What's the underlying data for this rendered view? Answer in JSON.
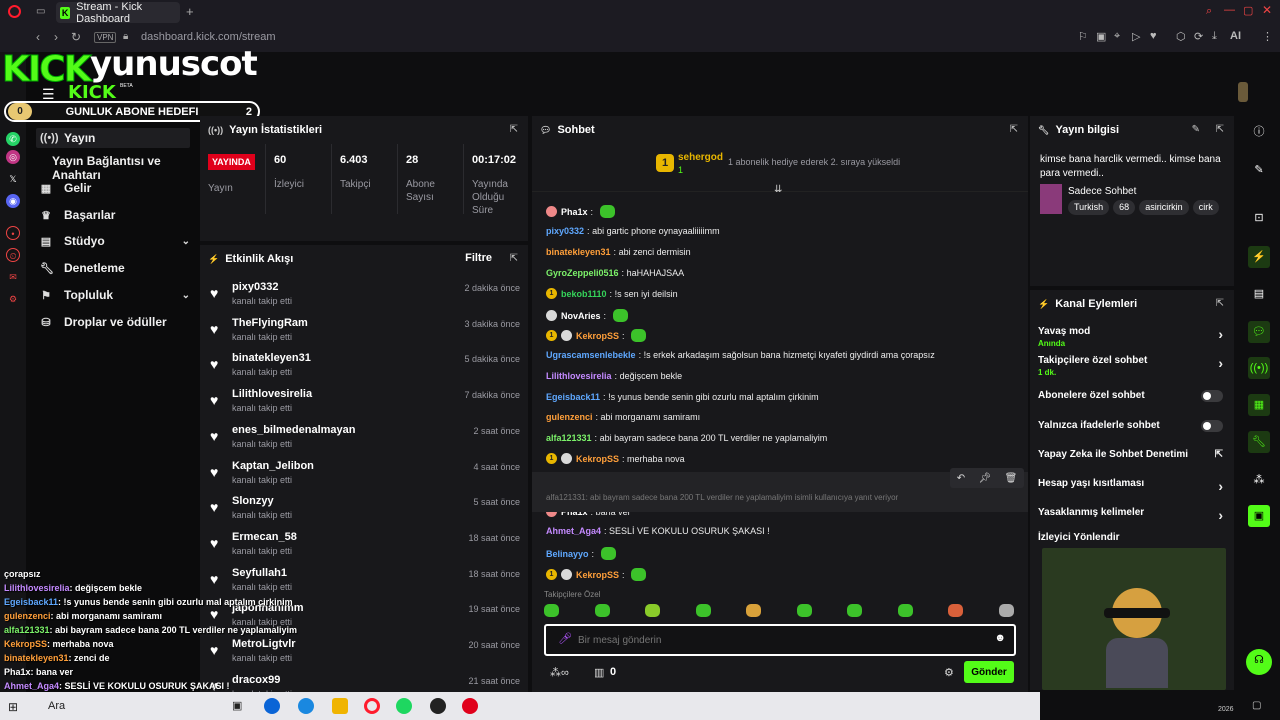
{
  "browser": {
    "tab_title": "Stream - Kick Dashboard",
    "url": "dashboard.kick.com/stream",
    "vpn": "VPN",
    "ai": "AI"
  },
  "overlay": {
    "brand": "KICK",
    "channel": "yunuscot",
    "brand_small": "KICK",
    "beta": "BETA",
    "goal_title": "GUNLUK ABONE HEDEFI",
    "goal_current": "0",
    "goal_target": "2"
  },
  "sidenav": [
    {
      "label": "Yayın",
      "icon": "broadcast-icon"
    },
    {
      "label": "Yayın Bağlantısı ve Anahtarı",
      "icon": ""
    },
    {
      "label": "Gelir",
      "icon": "chart-icon"
    },
    {
      "label": "Başarılar",
      "icon": "trophy-icon"
    },
    {
      "label": "Stüdyo",
      "icon": "studio-icon"
    },
    {
      "label": "Denetleme",
      "icon": "wrench-icon"
    },
    {
      "label": "Topluluk",
      "icon": "community-icon"
    },
    {
      "label": "Droplar ve ödüller",
      "icon": "drops-icon"
    }
  ],
  "stats": {
    "title": "Yayın İstatistikleri",
    "live_badge": "YAYINDA",
    "live_label": "Yayın",
    "viewers": "60",
    "viewers_label": "İzleyici",
    "followers": "6.403",
    "followers_label": "Takipçi",
    "subs": "28",
    "subs_label": "Abone Sayısı",
    "uptime": "00:17:02",
    "uptime_label": "Yayında Olduğu Süre"
  },
  "activity": {
    "title": "Etkinlik Akışı",
    "filter": "Filtre",
    "action": "kanalı takip etti",
    "events": [
      {
        "name": "pixy0332",
        "time": "2 dakika önce"
      },
      {
        "name": "TheFlyingRam",
        "time": "3 dakika önce"
      },
      {
        "name": "binatekleyen31",
        "time": "5 dakika önce"
      },
      {
        "name": "Lilithlovesirelia",
        "time": "7 dakika önce"
      },
      {
        "name": "enes_bilmedenalmayan",
        "time": "2 saat önce"
      },
      {
        "name": "Kaptan_Jelibon",
        "time": "4 saat önce"
      },
      {
        "name": "Slonzyy",
        "time": "5 saat önce"
      },
      {
        "name": "Ermecan_58",
        "time": "18 saat önce"
      },
      {
        "name": "Seyfullah1",
        "time": "18 saat önce"
      },
      {
        "name": "japonhanimm",
        "time": "19 saat önce"
      },
      {
        "name": "MetroLigtvlr",
        "time": "20 saat önce"
      },
      {
        "name": "dracox99",
        "time": "21 saat önce"
      }
    ]
  },
  "chat": {
    "title": "Sohbet",
    "pinned_user": "sehergod",
    "pinned_level": "1",
    "pinned_count": "1",
    "pinned_text": "1 abonelik hediye ederek 2. sıraya yükseldi",
    "messages": [
      {
        "user": "Pha1x",
        "color": "#ffffff",
        "text": "",
        "badges": [
          "pig"
        ],
        "emote": true
      },
      {
        "user": "pixy0332",
        "color": "#5fa8ff",
        "text": "abi gartic phone oynayaaliiiiimm",
        "badges": []
      },
      {
        "user": "binatekleyen31",
        "color": "#ff9f3a",
        "text": "abi zenci dermisin",
        "badges": []
      },
      {
        "user": "GyroZeppeli0516",
        "color": "#7cf26a",
        "text": "haHAHAJSAA",
        "badges": []
      },
      {
        "user": "bekob1110",
        "color": "#35d45a",
        "text": "!s sen iyi deilsin",
        "badges": [
          "sub"
        ]
      },
      {
        "user": "NovAries",
        "color": "#ffffff",
        "text": "",
        "badges": [
          "bot"
        ],
        "emote": true
      },
      {
        "user": "KekropSS",
        "color": "#ff9f3a",
        "text": "",
        "badges": [
          "sub",
          "bot"
        ],
        "emote": true
      },
      {
        "user": "Ugrascamsenlebekle",
        "color": "#5fa8ff",
        "text": "!s erkek arkadaşım sağolsun bana hizmetçi kıyafeti giydirdi ama çorapsız",
        "badges": []
      },
      {
        "user": "Lilithlovesirelia",
        "color": "#c48aff",
        "text": "değişcem bekle",
        "badges": []
      },
      {
        "user": "Egeisback11",
        "color": "#5fa8ff",
        "text": "!s yunus bende senin gibi ozurlu mal aptalım çirkinim",
        "badges": []
      },
      {
        "user": "gulenzenci",
        "color": "#ff9f3a",
        "text": "abi morganamı samiramı",
        "badges": []
      },
      {
        "user": "alfa121331",
        "color": "#7cf26a",
        "text": "abi bayram sadece bana 200 TL verdiler ne yaplamaliyim",
        "badges": []
      },
      {
        "user": "KekropSS",
        "color": "#ff9f3a",
        "text": "merhaba nova",
        "badges": [
          "sub",
          "bot"
        ]
      },
      {
        "user": "binatekleyen31",
        "color": "#ff9f3a",
        "text": "zenci de",
        "badges": []
      },
      {
        "user": "Pha1x",
        "color": "#ffffff",
        "text": "bana ver",
        "badges": [
          "pig"
        ]
      },
      {
        "user": "Ahmet_Aga4",
        "color": "#c48aff",
        "text": "SESLİ VE KOKULU OSURUK ŞAKASI !",
        "badges": []
      },
      {
        "user": "Belinayyo",
        "color": "#5fa8ff",
        "text": "",
        "badges": [],
        "emote": true
      },
      {
        "user": "KekropSS",
        "color": "#ff9f3a",
        "text": "",
        "badges": [
          "sub",
          "bot"
        ],
        "emote": true
      }
    ],
    "reply_preview": "alfa121331: abi bayram sadece bana 200 TL verdiler ne yaplamaliyim isimli kullanıcıya yanıt veriyor",
    "followers_only": "Takipçilere Özel",
    "input_placeholder": "Bir mesaj gönderin",
    "points": "0",
    "send": "Gönder"
  },
  "stream_info": {
    "title": "Yayın bilgisi",
    "stream_title": "kimse bana harclik vermedi.. kimse bana para vermedi..",
    "category": "Sadece Sohbet",
    "tags": [
      "Turkish",
      "68",
      "asiricirkin",
      "cirk"
    ]
  },
  "channel_actions": {
    "title": "Kanal Eylemleri",
    "items": [
      {
        "label": "Yavaş mod",
        "sub": "Anında",
        "control": "chevron"
      },
      {
        "label": "Takipçilere özel sohbet",
        "sub": "1 dk.",
        "control": "chevron"
      },
      {
        "label": "Abonelere özel sohbet",
        "sub": "",
        "control": "toggle"
      },
      {
        "label": "Yalnızca ifadelerle sohbet",
        "sub": "",
        "control": "toggle"
      },
      {
        "label": "Yapay Zeka ile Sohbet Denetimi",
        "sub": "",
        "control": "external"
      },
      {
        "label": "Hesap yaşı kısıtlaması",
        "sub": "",
        "control": "chevron"
      },
      {
        "label": "Yasaklanmış kelimeler",
        "sub": "",
        "control": "chevron"
      },
      {
        "label": "İzleyici Yönlendir",
        "sub": "",
        "control": "none"
      }
    ]
  },
  "overlay_chat": [
    {
      "user": "",
      "text": "çorapsız",
      "color": "#ffffff"
    },
    {
      "user": "Lilithlovesirelia",
      "text": ": değişcem bekle",
      "color": "#c48aff"
    },
    {
      "user": "Egeisback11",
      "text": ": !s yunus bende senin gibi ozurlu mal aptalım çirkinim",
      "color": "#5fa8ff"
    },
    {
      "user": "gulenzenci",
      "text": ": abi morganamı samiramı",
      "color": "#ff9f3a"
    },
    {
      "user": "alfa121331",
      "text": ": abi bayram sadece bana 200 TL verdiler ne yaplamaliyim",
      "color": "#7cf26a"
    },
    {
      "user": "KekropSS",
      "text": ": merhaba nova",
      "color": "#ff9f3a"
    },
    {
      "user": "binatekleyen31",
      "text": ": zenci de",
      "color": "#ff9f3a"
    },
    {
      "user": "Pha1x",
      "text": ": bana ver",
      "color": "#ffffff"
    },
    {
      "user": "Ahmet_Aga4",
      "text": ": SESLİ VE KOKULU OSURUK ŞAKASI !",
      "color": "#c48aff"
    }
  ],
  "taskbar": {
    "search": "Ara",
    "clock_year": "2026"
  }
}
